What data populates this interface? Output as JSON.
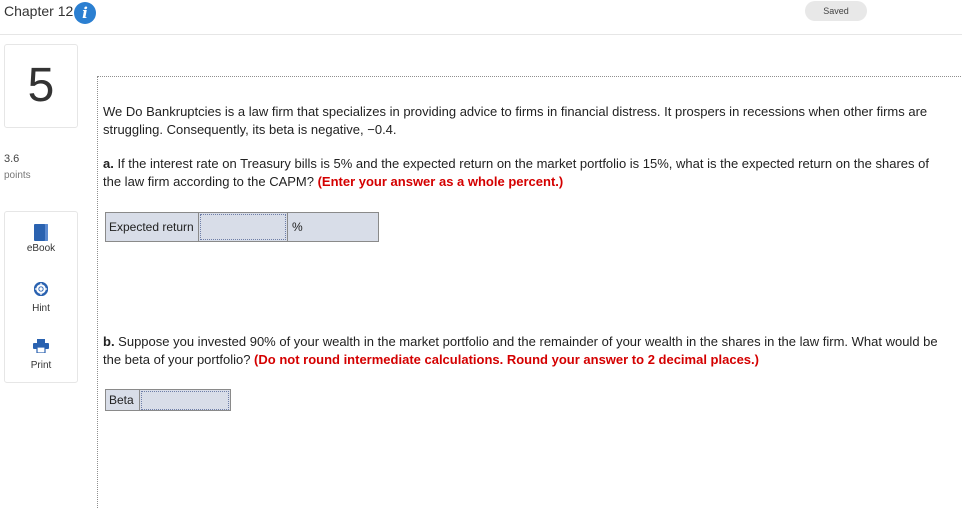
{
  "header": {
    "chapter": "Chapter 12",
    "info_icon": "info-icon",
    "saved": "Saved"
  },
  "question": {
    "number": "5",
    "points_value": "3.6",
    "points_label": "points"
  },
  "tools": {
    "ebook": {
      "label": "eBook",
      "icon": "book-icon"
    },
    "hint": {
      "label": "Hint",
      "icon": "lifebuoy-icon"
    },
    "print": {
      "label": "Print",
      "icon": "printer-icon"
    }
  },
  "problem": {
    "intro": "We Do Bankruptcies is a law firm that specializes in providing advice to firms in financial distress. It prospers in recessions when other firms are struggling. Consequently, its beta is negative, −0.4.",
    "part_a": {
      "label": "a.",
      "text": " If the interest rate on Treasury bills is 5% and the expected return on the market portfolio is 15%, what is the expected return on the shares of the law firm according to the CAPM? ",
      "instruction": "(Enter your answer as a whole percent.)",
      "row_label": "Expected return",
      "value": "",
      "unit": "%"
    },
    "part_b": {
      "label": "b.",
      "text": " Suppose you invested 90% of your wealth in the market portfolio and the remainder of your wealth in the shares in the law firm. What would be the beta of your portfolio? ",
      "instruction": "(Do not round intermediate calculations. Round your answer to 2 decimal places.)",
      "row_label": "Beta",
      "value": ""
    }
  },
  "colors": {
    "accent_blue": "#2b7fd1",
    "instruction_red": "#d40000",
    "answer_cell": "#d8dde8"
  }
}
